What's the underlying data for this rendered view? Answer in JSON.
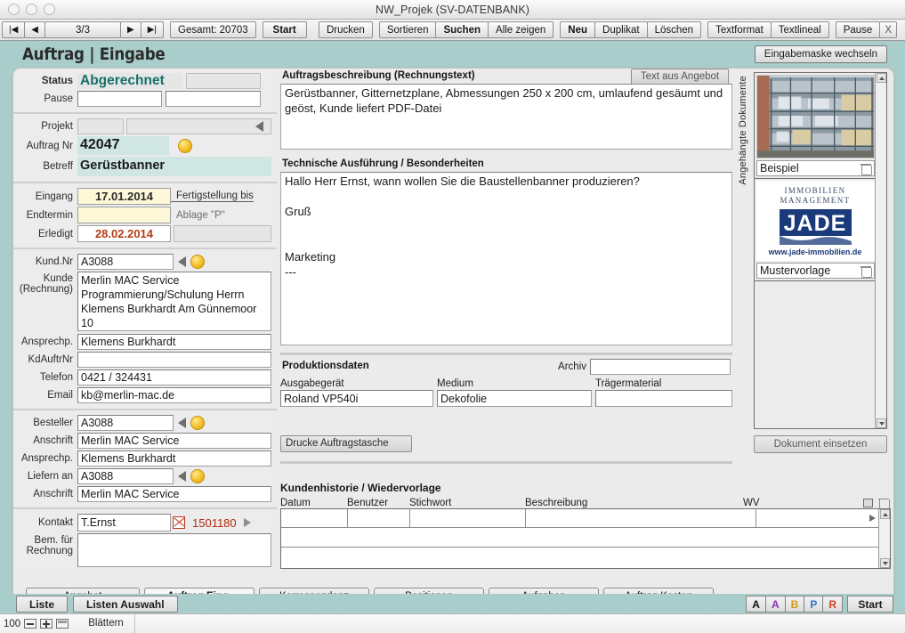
{
  "window": {
    "title": "NW_Projek (SV-DATENBANK)"
  },
  "toolbar": {
    "first_label": "|◀",
    "prev_label": "◀",
    "counter": "3/3",
    "next_label": "▶",
    "last_label": "▶|",
    "total": "Gesamt: 20703",
    "start": "Start",
    "drucken": "Drucken",
    "sortieren": "Sortieren",
    "suchen": "Suchen",
    "alle_zeigen": "Alle zeigen",
    "neu": "Neu",
    "duplikat": "Duplikat",
    "loeschen": "Löschen",
    "textformat": "Textformat",
    "textlineal": "Textlineal",
    "pause": "Pause",
    "close": "X"
  },
  "header": {
    "headline": "Auftrag | Eingabe",
    "switch_mask": "Eingabemaske wechseln"
  },
  "left": {
    "status_label": "Status",
    "status_value": "Abgerechnet",
    "status_extra": "",
    "pause_label": "Pause",
    "pause_value": "",
    "pause_value2": "",
    "projekt_label": "Projekt",
    "projekt_value": "",
    "projekt_value2": "",
    "auftrag_nr_label": "Auftrag Nr",
    "auftrag_nr_value": "42047",
    "betreff_label": "Betreff",
    "betreff_value": "Gerüstbanner",
    "eingang_label": "Eingang",
    "eingang_value": "17.01.2014",
    "fertigstellung_label": "Fertigstellung bis",
    "endtermin_label": "Endtermin",
    "endtermin_value": "",
    "ablage_label": "Ablage \"P\"",
    "ablage_value": "",
    "erledigt_label": "Erledigt",
    "erledigt_value": "28.02.2014",
    "kundnr_label": "Kund.Nr",
    "kundnr_value": "A3088",
    "kunde_label": "Kunde",
    "kunde_label2": "(Rechnung)",
    "kunde_value": "Merlin MAC Service\nProgrammierung/Schulung\nHerrn Klemens Burkhardt\nAm Günnemoor 10",
    "ansprechp_label": "Ansprechp.",
    "ansprechp_value": "Klemens Burkhardt",
    "kdauftrnr_label": "KdAuftrNr",
    "kdauftrnr_value": "",
    "telefon_label": "Telefon",
    "telefon_value": "0421 / 324431",
    "email_label": "Email",
    "email_value": "kb@merlin-mac.de",
    "besteller_label": "Besteller",
    "besteller_value": "A3088",
    "anschrift_label": "Anschrift",
    "anschrift_value": "Merlin MAC Service",
    "ansprechp2_label": "Ansprechp.",
    "ansprechp2_value": "Klemens Burkhardt",
    "liefern_label": "Liefern an",
    "liefern_value": "A3088",
    "anschrift2_label": "Anschrift",
    "anschrift2_value": "Merlin MAC Service",
    "kontakt_label": "Kontakt",
    "kontakt_value": "T.Ernst",
    "kontakt_number": "1501180",
    "bem_label": "Bem. für",
    "bem_label2": "Rechnung",
    "bem_value": ""
  },
  "center": {
    "beschreibung_title": "Auftragsbeschreibung (Rechnungstext)",
    "text_aus_angebot": "Text aus Angebot",
    "beschreibung_text": "Gerüstbanner, Gitternetzplane, Abmessungen 250 x 200 cm, umlaufend gesäumt und geöst, Kunde liefert PDF-Datei",
    "technische_title": "Technische Ausführung / Besonderheiten",
    "technische_text": "Hallo Herr Ernst, wann wollen Sie die Baustellenbanner produzieren?\n\nGruß\n\n\nMarketing\n---",
    "produktionsdaten_title": "Produktionsdaten",
    "archiv_label": "Archiv",
    "archiv_value": "",
    "ausgabegeraet_label": "Ausgabegerät",
    "ausgabegeraet_value": "Roland VP540i",
    "medium_label": "Medium",
    "medium_value": "Dekofolie",
    "traegermaterial_label": "Trägermaterial",
    "traegermaterial_value": "",
    "drucke_auftragstasche": "Drucke Auftragstasche"
  },
  "documents": {
    "side_label": "Angehängte Dokumente",
    "items": [
      {
        "caption": "Beispiel",
        "kind": "photo-scaffolding"
      },
      {
        "caption": "Mustervorlage",
        "kind": "logo-jade"
      }
    ],
    "logo": {
      "line1": "IMMOBILIEN",
      "line2": "MANAGEMENT",
      "word": "JADE",
      "url": "www.jade-immobilien.de"
    },
    "insert_button": "Dokument einsetzen"
  },
  "history": {
    "title": "Kundenhistorie / Wiedervorlage",
    "columns": [
      "Datum",
      "Benutzer",
      "Stichwort",
      "Beschreibung",
      "WV"
    ],
    "rows": [
      {
        "datum": "",
        "benutzer": "",
        "stichwort": "",
        "beschreibung": "",
        "wv": ""
      }
    ]
  },
  "tabs": [
    {
      "label": "Angebot",
      "active": false
    },
    {
      "label": "Auftrag Eing.",
      "active": true
    },
    {
      "label": "Korrespondenz",
      "active": false
    },
    {
      "label": "Positionen",
      "active": false
    },
    {
      "label": "Aufgaben",
      "active": false
    },
    {
      "label": "Auftrag Kosten",
      "active": false
    }
  ],
  "bottom": {
    "liste": "Liste",
    "listen_auswahl": "Listen Auswahl",
    "color_buttons": [
      {
        "label": "A",
        "color": "#111111"
      },
      {
        "label": "A",
        "color": "#8b2fb8"
      },
      {
        "label": "B",
        "color": "#d09a16"
      },
      {
        "label": "P",
        "color": "#2f73c8"
      },
      {
        "label": "R",
        "color": "#d8431a"
      }
    ],
    "start": "Start"
  },
  "statusbar": {
    "zoom": "100",
    "blaettern": "Blättern"
  }
}
